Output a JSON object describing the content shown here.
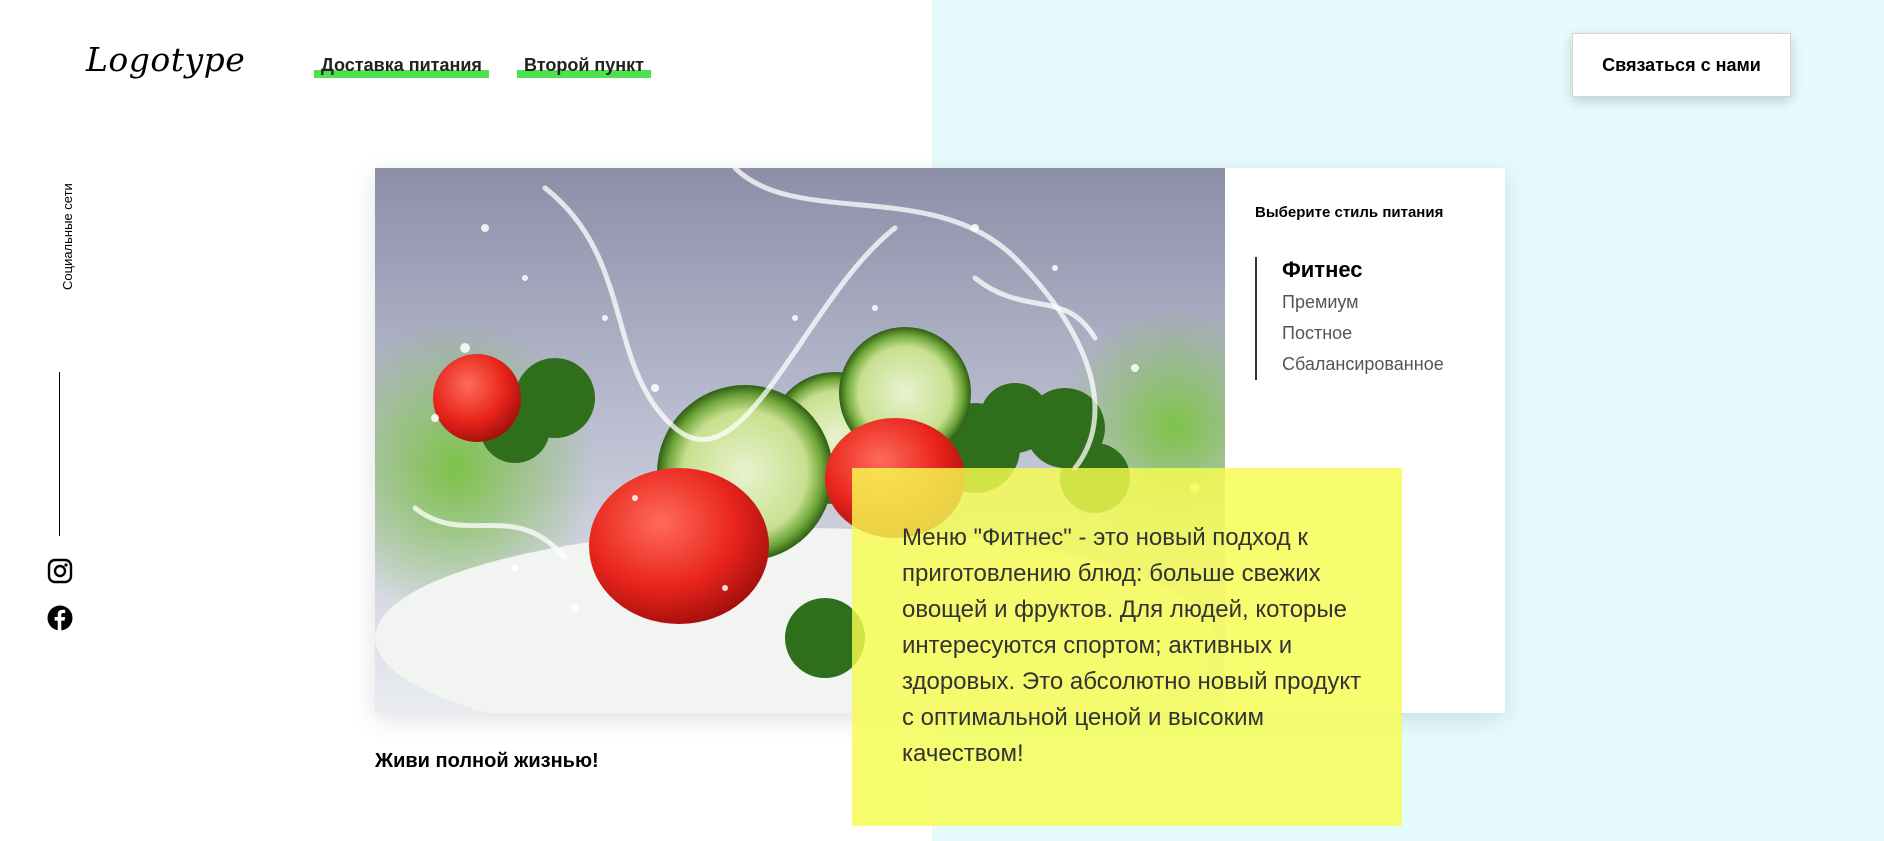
{
  "header": {
    "logo": "Logotype",
    "nav": [
      {
        "label": "Доставка питания"
      },
      {
        "label": "Второй пункт"
      }
    ],
    "contact_button": "Связаться с нами",
    "accent_color": "#4ee04f"
  },
  "social": {
    "label": "Социальные сети",
    "icons": [
      "instagram-icon",
      "facebook-icon"
    ]
  },
  "diet": {
    "heading": "Выберите стиль питания",
    "options": [
      {
        "label": "Фитнес",
        "active": true
      },
      {
        "label": "Премиум",
        "active": false
      },
      {
        "label": "Постное",
        "active": false
      },
      {
        "label": "Сбалансированное",
        "active": false
      }
    ]
  },
  "description": "Меню \"Фитнес\" - это новый подход к приготовлению блюд: больше свежих овощей и фруктов. Для людей, которые интересуются спортом; активных и здоровых. Это абсолютно новый продукт с оптимальной ценой и высоким качеством!",
  "tagline": "Живи полной жизнью!",
  "colors": {
    "right_background": "#e6fbfd",
    "highlight_box": "#f6fc50"
  }
}
